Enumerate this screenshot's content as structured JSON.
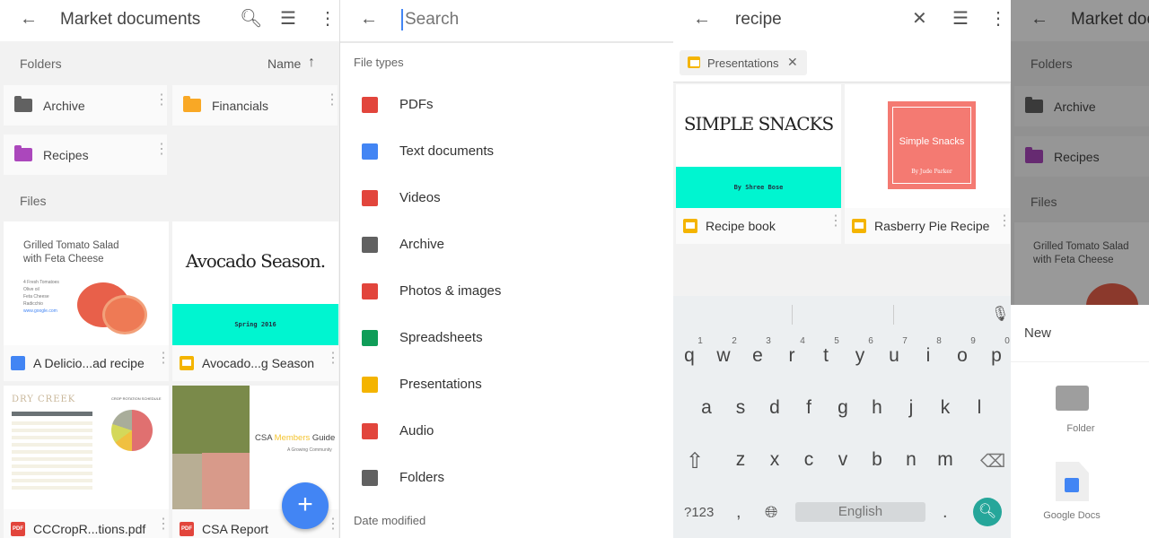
{
  "screen1": {
    "title": "Market documents",
    "icons": [
      "arrow-back",
      "search",
      "list-view",
      "more-vert"
    ],
    "folders_label": "Folders",
    "sort_label": "Name",
    "sort_icon": "arrow-up",
    "folders": [
      {
        "name": "Archive",
        "color": "#616161"
      },
      {
        "name": "Financials",
        "color": "#f9a825"
      },
      {
        "name": "Recipes",
        "color": "#ab47bc"
      }
    ],
    "files_label": "Files",
    "files": [
      {
        "name": "A Delicio...ad recipe",
        "type": "doc",
        "thumb_title": "Grilled Tomato Salad with Feta Cheese",
        "thumb_lines": [
          "4 Fresh Tomatoes",
          "Olive oil",
          "Feta Cheese",
          "Radicchio",
          "www.google.com"
        ]
      },
      {
        "name": "Avocado...g Season",
        "type": "slides",
        "thumb_title": "Avocado Season.",
        "thumb_sub": "Spring 2016"
      },
      {
        "name": "CCCropR...tions.pdf",
        "type": "pdf",
        "thumb_title": "DRY CREEK",
        "thumb_sub": "CROP ROTATION SCHEDULE"
      },
      {
        "name": "CSA Report",
        "type": "pdf",
        "thumb_title_a": "CSA ",
        "thumb_title_b": "Members",
        "thumb_title_c": " Guide",
        "thumb_sub": "A Growing Community"
      }
    ],
    "fab_label": "+"
  },
  "screen2": {
    "search_placeholder": "Search",
    "file_types_label": "File types",
    "file_types": [
      {
        "label": "PDFs",
        "icon": "pdf",
        "color": "#e2453c"
      },
      {
        "label": "Text documents",
        "icon": "doc",
        "color": "#4285f4"
      },
      {
        "label": "Videos",
        "icon": "video",
        "color": "#e2453c"
      },
      {
        "label": "Archive",
        "icon": "archive",
        "color": "#616161"
      },
      {
        "label": "Photos & images",
        "icon": "image",
        "color": "#e2453c"
      },
      {
        "label": "Spreadsheets",
        "icon": "sheet",
        "color": "#0f9d58"
      },
      {
        "label": "Presentations",
        "icon": "slides",
        "color": "#f4b400"
      },
      {
        "label": "Audio",
        "icon": "audio",
        "color": "#e2453c"
      },
      {
        "label": "Folders",
        "icon": "folder",
        "color": "#616161"
      }
    ],
    "date_modified_label": "Date modified"
  },
  "screen3": {
    "query": "recipe",
    "chip": "Presentations",
    "results": [
      {
        "name": "Recipe book",
        "thumb_title": "Simple Snacks",
        "thumb_sub": "By Shree Bose"
      },
      {
        "name": "Rasberry Pie Recipe",
        "thumb_title": "Simple Snacks",
        "thumb_sub": "By Jude Parker"
      }
    ],
    "keyboard": {
      "numbers": [
        "1",
        "2",
        "3",
        "4",
        "5",
        "6",
        "7",
        "8",
        "9",
        "0"
      ],
      "row1": [
        "q",
        "w",
        "e",
        "r",
        "t",
        "y",
        "u",
        "i",
        "o",
        "p"
      ],
      "row2": [
        "a",
        "s",
        "d",
        "f",
        "g",
        "h",
        "j",
        "k",
        "l"
      ],
      "row3": [
        "z",
        "x",
        "c",
        "v",
        "b",
        "n",
        "m"
      ],
      "symbols": "?123",
      "comma": ",",
      "space": "English",
      "period": "."
    }
  },
  "screen4": {
    "title": "Market doc",
    "folders_label": "Folders",
    "folders": [
      "Archive",
      "Recipes"
    ],
    "files_label": "Files",
    "preview_title": "Grilled Tomato Salad with Feta Cheese",
    "sheet_title": "New",
    "options": [
      {
        "label": "Folder",
        "icon": "folder"
      },
      {
        "label": "Google Docs",
        "icon": "google-docs"
      }
    ]
  },
  "colors": {
    "accent": "#4285f4",
    "teal": "#00f5d0",
    "fab": "#4285f4",
    "search_green": "#26a69a"
  }
}
